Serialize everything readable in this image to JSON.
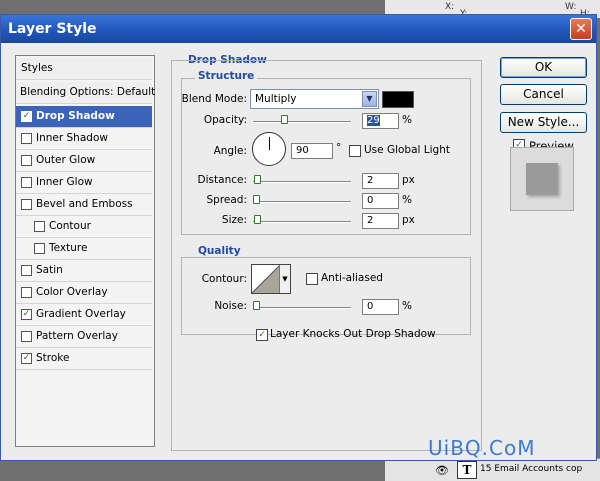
{
  "background": {
    "top_labels": [
      "X:",
      "Y:",
      "W:",
      "H:"
    ],
    "layer_label": "15 Email Accounts cop",
    "layer_type_letter": "T"
  },
  "dialog": {
    "title": "Layer Style",
    "close_glyph": "✕"
  },
  "styles_list": {
    "header": "Styles",
    "blending": "Blending Options: Default",
    "items": [
      {
        "label": "Drop Shadow",
        "checked": true,
        "selected": true
      },
      {
        "label": "Inner Shadow",
        "checked": false
      },
      {
        "label": "Outer Glow",
        "checked": false
      },
      {
        "label": "Inner Glow",
        "checked": false
      },
      {
        "label": "Bevel and Emboss",
        "checked": false
      },
      {
        "label": "Contour",
        "checked": false,
        "sub": true
      },
      {
        "label": "Texture",
        "checked": false,
        "sub": true
      },
      {
        "label": "Satin",
        "checked": false
      },
      {
        "label": "Color Overlay",
        "checked": false
      },
      {
        "label": "Gradient Overlay",
        "checked": true
      },
      {
        "label": "Pattern Overlay",
        "checked": false
      },
      {
        "label": "Stroke",
        "checked": true
      }
    ]
  },
  "drop_shadow": {
    "title": "Drop Shadow",
    "structure_title": "Structure",
    "blend_mode_label": "Blend Mode:",
    "blend_mode_value": "Multiply",
    "shadow_color": "#000000",
    "opacity_label": "Opacity:",
    "opacity_value": "29",
    "opacity_level": 0.29,
    "angle_label": "Angle:",
    "angle_value": "90",
    "angle_unit": "°",
    "global_light_label": "Use Global Light",
    "global_light_checked": false,
    "distance_label": "Distance:",
    "distance_value": "2",
    "distance_unit": "px",
    "spread_label": "Spread:",
    "spread_value": "0",
    "spread_unit": "%",
    "size_label": "Size:",
    "size_value": "2",
    "size_unit": "px",
    "percent_unit": "%",
    "quality_title": "Quality",
    "contour_label": "Contour:",
    "anti_aliased_label": "Anti-aliased",
    "anti_aliased_checked": false,
    "noise_label": "Noise:",
    "noise_value": "0",
    "noise_unit": "%",
    "knocks_out_label": "Layer Knocks Out Drop Shadow",
    "knocks_out_checked": true
  },
  "buttons": {
    "ok": "OK",
    "cancel": "Cancel",
    "new_style": "New Style...",
    "preview": "Preview",
    "preview_checked": true
  },
  "watermark": "UiBQ.CoM",
  "colors": {
    "title_bar": "#1f54b8",
    "selected_item": "#3a63b9",
    "legend_text": "#204aa3",
    "watermark": "#3a7bd5"
  }
}
